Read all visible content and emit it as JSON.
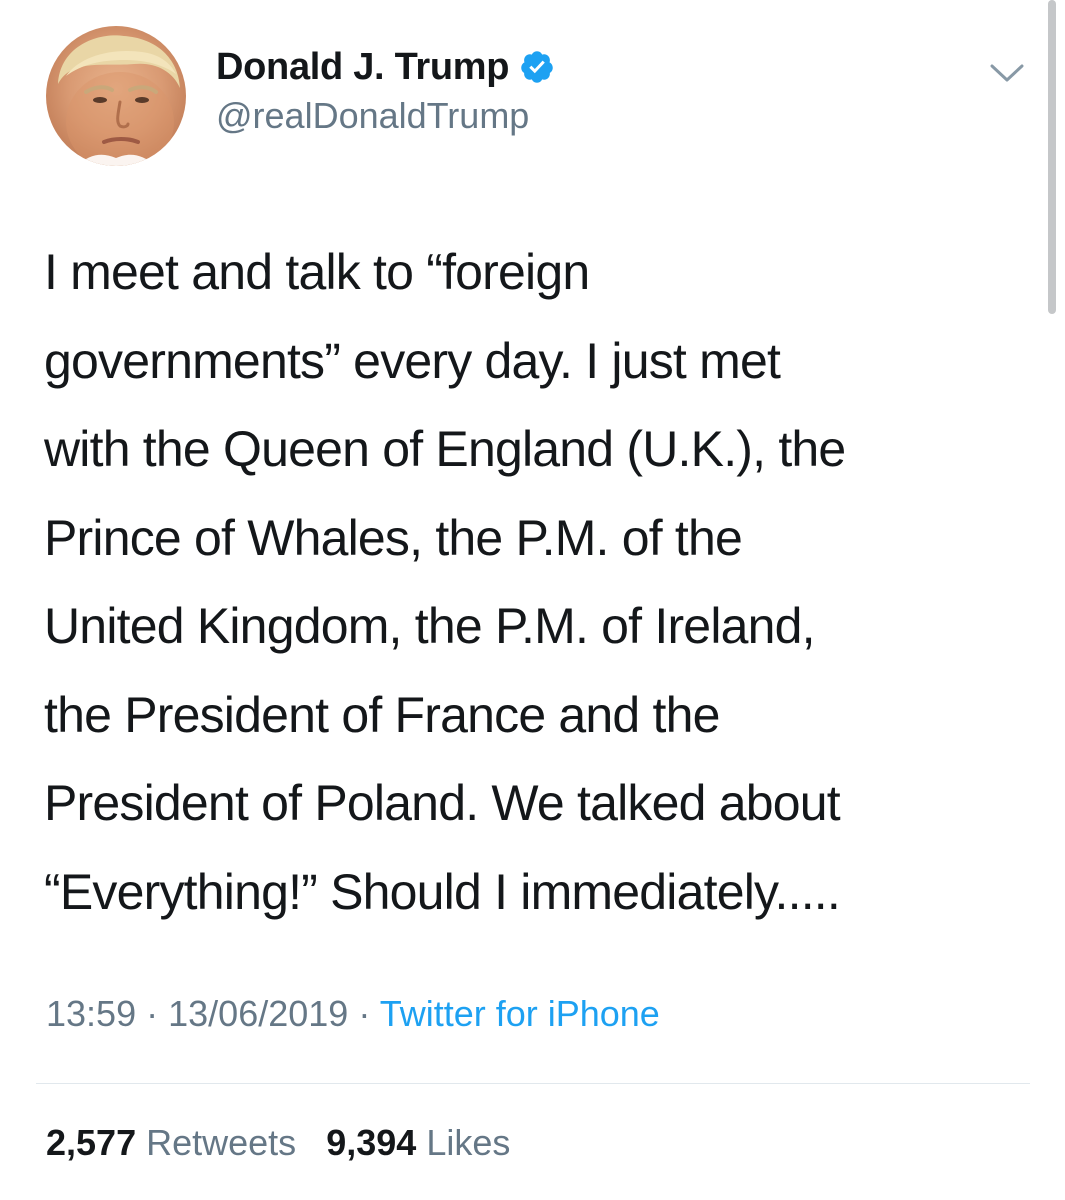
{
  "author": {
    "display_name": "Donald J. Trump",
    "handle": "@realDonaldTrump",
    "verified": true,
    "avatar_icon": "profile-photo",
    "verified_icon": "verified-badge-icon",
    "menu_icon": "chevron-down-icon"
  },
  "tweet": {
    "lines": [
      "I meet and talk to “foreign",
      "governments” every day. I just met",
      "with the Queen of England (U.K.), the",
      "Prince of Whales, the P.M. of the",
      "United Kingdom, the P.M. of Ireland,",
      "the President of France and the",
      "President of Poland. We talked about",
      "“Everything!” Should I immediately....."
    ]
  },
  "meta": {
    "time": "13:59",
    "separator": "·",
    "date": "13/06/2019",
    "source": "Twitter for iPhone"
  },
  "stats": {
    "retweets_count": "2,577",
    "retweets_label": "Retweets",
    "likes_count": "9,394",
    "likes_label": "Likes"
  },
  "colors": {
    "text": "#14171a",
    "secondary": "#657786",
    "accent": "#1da1f2",
    "divider": "#e1e8ed"
  }
}
